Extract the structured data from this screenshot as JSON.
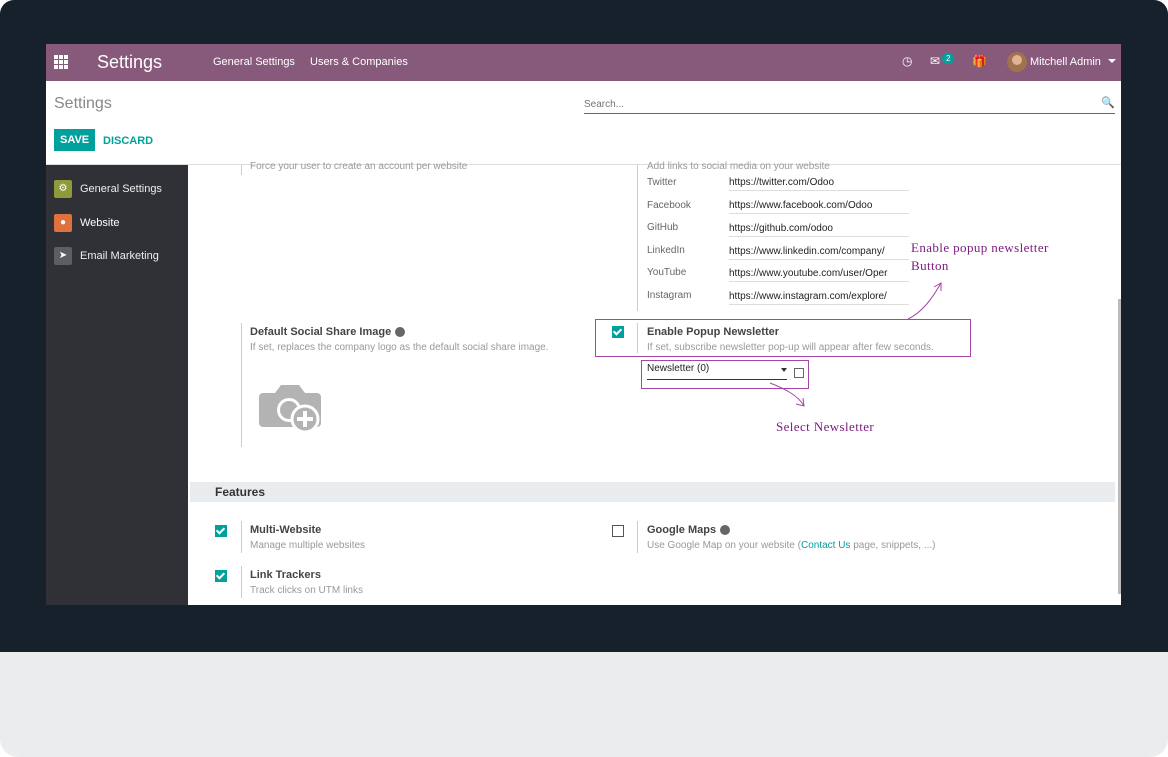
{
  "navbar": {
    "brand": "Settings",
    "menu": [
      "General Settings",
      "Users & Companies"
    ],
    "messages_badge": "2",
    "user": "Mitchell Admin"
  },
  "control_panel": {
    "title": "Settings",
    "search_placeholder": "Search...",
    "save": "SAVE",
    "discard": "DISCARD"
  },
  "sidebar": {
    "items": [
      {
        "label": "General Settings",
        "color": "#8f9a3a"
      },
      {
        "label": "Website",
        "color": "#e0713f"
      },
      {
        "label": "Email Marketing",
        "color": "#5b5e63"
      }
    ]
  },
  "content": {
    "faded_left": "Force your user to create an account per website",
    "faded_right": "Add links to social media on your website",
    "social": [
      {
        "name": "Twitter",
        "url": "https://twitter.com/Odoo"
      },
      {
        "name": "Facebook",
        "url": "https://www.facebook.com/Odoo"
      },
      {
        "name": "GitHub",
        "url": "https://github.com/odoo"
      },
      {
        "name": "LinkedIn",
        "url": "https://www.linkedin.com/company/"
      },
      {
        "name": "YouTube",
        "url": "https://www.youtube.com/user/Oper"
      },
      {
        "name": "Instagram",
        "url": "https://www.instagram.com/explore/"
      }
    ],
    "share_image": {
      "title": "Default Social Share Image",
      "desc": "If set, replaces the company logo as the default social share image."
    },
    "popup": {
      "title": "Enable Popup Newsletter",
      "desc": "If set, subscribe newsletter pop-up will appear after few seconds.",
      "checked": true,
      "select_value": "Newsletter (0)"
    },
    "features": {
      "heading": "Features",
      "multi_website": {
        "title": "Multi-Website",
        "desc": "Manage multiple websites",
        "checked": true
      },
      "google_maps": {
        "title": "Google Maps",
        "desc_before": "Use Google Map on your website (",
        "link": "Contact Us",
        "desc_after": " page, snippets, ...)",
        "checked": false
      },
      "link_trackers": {
        "title": "Link Trackers",
        "desc": "Track clicks on UTM links",
        "checked": true
      }
    }
  },
  "annotations": {
    "popup_note_line1": "Enable  popup  newsletter",
    "popup_note_line2": "Button",
    "select_note": "Select  Newsletter"
  },
  "colors": {
    "brand": "#875a7b",
    "accent": "#00a09d",
    "annotation": "#7b1a7f"
  }
}
